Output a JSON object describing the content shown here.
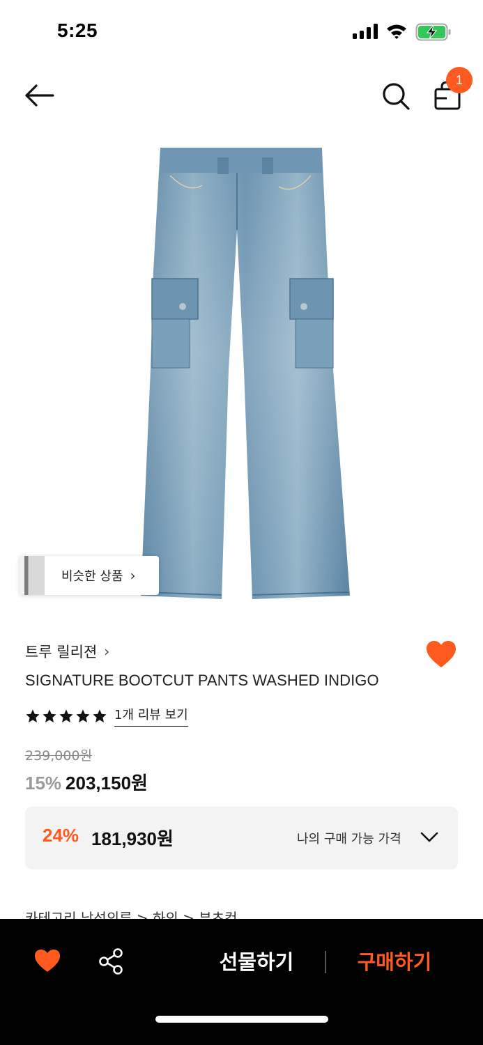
{
  "status_bar": {
    "time": "5:25"
  },
  "header": {
    "cart_count": "1"
  },
  "product": {
    "similar_label": "비슷한 상품",
    "brand": "트루 릴리젼",
    "title": "SIGNATURE BOOTCUT PANTS WASHED INDIGO",
    "rating": 5,
    "review_link": "1개 리뷰 보기",
    "original_price": "239,000원",
    "discount_rate": "15%",
    "sale_price": "203,150원",
    "my_price": {
      "rate": "24%",
      "value": "181,930원",
      "label": "나의 구매 가능 가격"
    },
    "category_peek": "카테고리        남성의류  >  하의  >  부츠컷"
  },
  "bottom_bar": {
    "gift_label": "선물하기",
    "buy_label": "구매하기"
  },
  "colors": {
    "accent": "#ff5a1f",
    "bar_background": "#000000"
  }
}
